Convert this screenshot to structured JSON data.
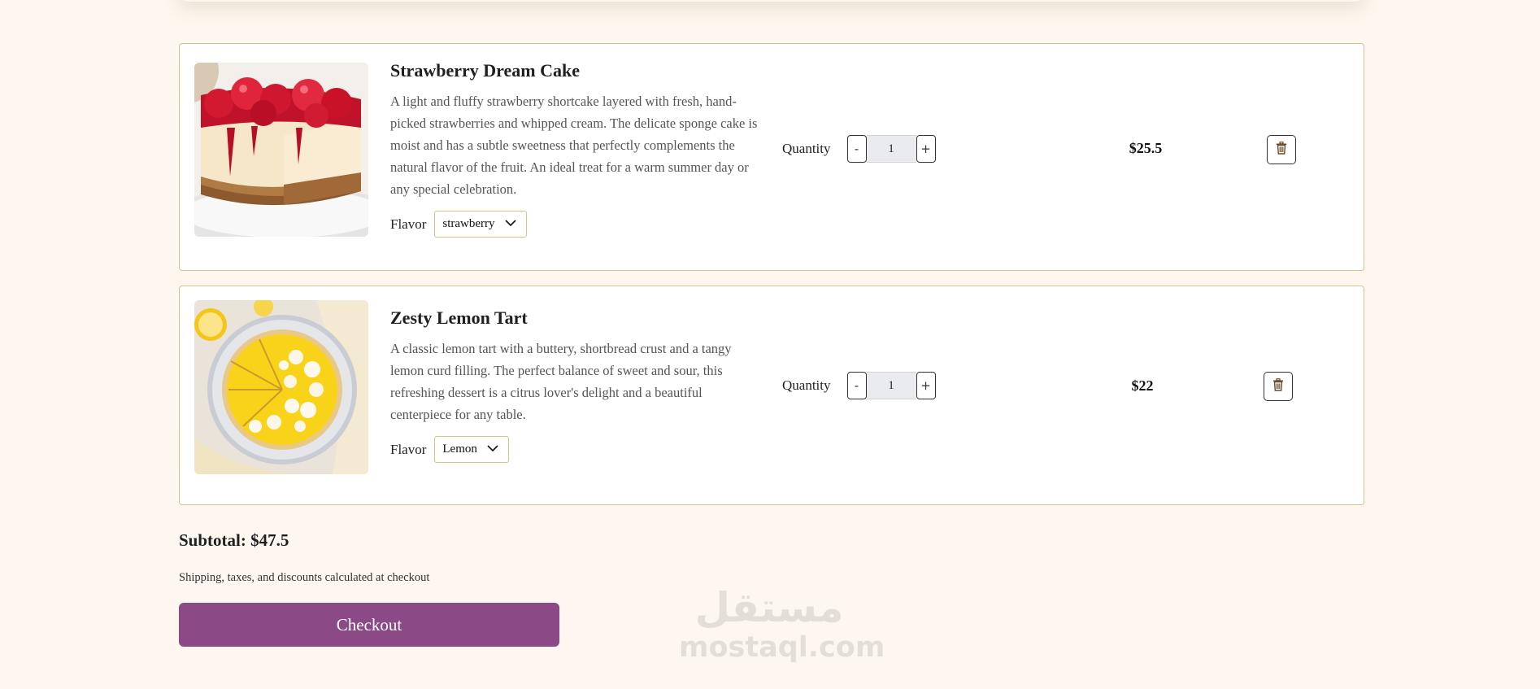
{
  "cart": {
    "items": [
      {
        "title": "Strawberry Dream Cake",
        "description": "A light and fluffy strawberry shortcake layered with fresh, hand-picked strawberries and whipped cream. The delicate sponge cake is moist and has a subtle sweetness that perfectly complements the natural flavor of the fruit. An ideal treat for a warm summer day or any special celebration.",
        "flavor_label": "Flavor",
        "flavor_value": "strawberry",
        "quantity_label": "Quantity",
        "quantity": "1",
        "decrement_label": "-",
        "increment_label": "+",
        "price": "$25.5"
      },
      {
        "title": "Zesty Lemon Tart",
        "description": "A classic lemon tart with a buttery, shortbread crust and a tangy lemon curd filling. The perfect balance of sweet and sour, this refreshing dessert is a citrus lover's delight and a beautiful centerpiece for any table.",
        "flavor_label": "Flavor",
        "flavor_value": "Lemon",
        "quantity_label": "Quantity",
        "quantity": "1",
        "decrement_label": "-",
        "increment_label": "+",
        "price": "$22"
      }
    ]
  },
  "summary": {
    "subtotal": "Subtotal: $47.5",
    "shipping_note": "Shipping, taxes, and discounts calculated at checkout",
    "checkout_label": "Checkout"
  },
  "watermark": {
    "script": "مستقل",
    "domain": "mostaql.com"
  },
  "icons": {
    "delete": "trash-icon",
    "dropdown": "chevron-down-icon"
  },
  "colors": {
    "background": "#fdf7ef",
    "card_border": "#cfc48a",
    "checkout_button": "#8b4a86",
    "stepper_value_bg": "#e9ebee"
  }
}
